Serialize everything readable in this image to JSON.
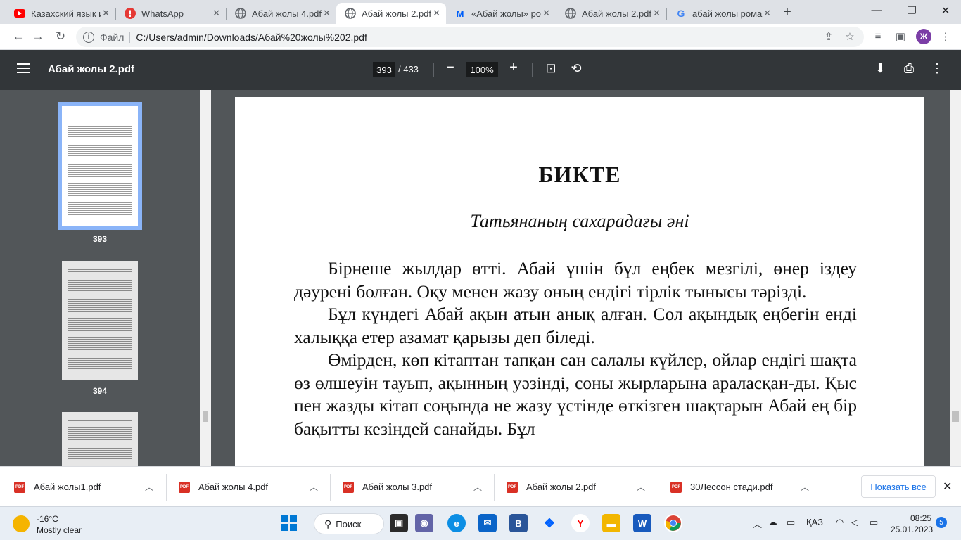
{
  "tabs": [
    {
      "title": "Казахский язык и",
      "icon": "youtube-icon",
      "active": false
    },
    {
      "title": "WhatsApp",
      "icon": "whatsapp-icon",
      "active": false
    },
    {
      "title": "Абай жолы 4.pdf",
      "icon": "globe-icon",
      "active": false
    },
    {
      "title": "Абай жолы 2.pdf",
      "icon": "globe-icon",
      "active": true
    },
    {
      "title": "«Абай жолы» ро",
      "icon": "mail-ru-icon",
      "active": false
    },
    {
      "title": "Абай жолы 2.pdf",
      "icon": "globe-icon",
      "active": false
    },
    {
      "title": "абай жолы рома",
      "icon": "google-icon",
      "active": false
    }
  ],
  "address": {
    "scheme": "Файл",
    "url": "C:/Users/admin/Downloads/Абай%20жолы%202.pdf"
  },
  "profile_initial": "Ж",
  "pdf": {
    "title": "Абай жолы 2.pdf",
    "current_page": "393",
    "total_pages": "/ 433",
    "zoom": "100%"
  },
  "thumbnails": [
    {
      "label": "393",
      "selected": true
    },
    {
      "label": "394",
      "selected": false
    }
  ],
  "page": {
    "title": "БИКТЕ",
    "subtitle": "Татьянаның сахарадағы әні",
    "paragraphs": [
      "Бірнеше жылдар өтті. Абай үшін бұл еңбек мезгілі, өнер іздеу дәурені болған. Оқу менен жазу оның ендігі тірлік тынысы тәрізді.",
      "Бұл күндегі Абай ақын атын анық алған. Сол ақындық еңбегін енді халыққа етер азамат қарызы деп біледі.",
      "Өмірден, көп кітаптан тапқан сан салалы күйлер, ойлар ендігі шақта өз өлшеуін тауып, ақынның уәзінді, соны жырларына араласқан-ды. Қыс пен жазды кітап соңында не жазу үстінде өткізген шақтарын Абай ең бір бақытты кезіндей санайды. Бұл"
    ]
  },
  "downloads": [
    {
      "name": "Абай жолы1.pdf"
    },
    {
      "name": "Абай жолы 4.pdf"
    },
    {
      "name": "Абай жолы 3.pdf"
    },
    {
      "name": "Абай жолы 2.pdf"
    },
    {
      "name": "30Лессон стади.pdf"
    }
  ],
  "downloads_show_all": "Показать все",
  "taskbar": {
    "weather_temp": "-16°C",
    "weather_desc": "Mostly clear",
    "search_label": "Поиск",
    "language": "ҚАЗ",
    "time": "08:25",
    "date": "25.01.2023",
    "notifications": "5"
  }
}
